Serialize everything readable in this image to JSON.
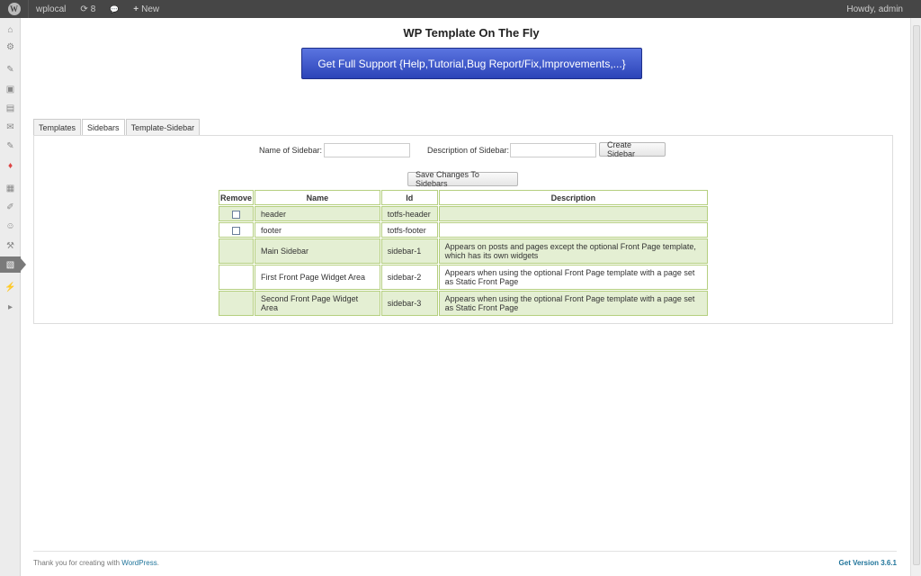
{
  "adminbar": {
    "site_name": "wplocal",
    "updates_count": "8",
    "new_label": "New",
    "howdy": "Howdy, admin"
  },
  "icons": {
    "wp": "W",
    "updates": "⟳",
    "comments": "💬",
    "new": "+"
  },
  "menu_icons": [
    "⌂",
    "⚙",
    "✎",
    "▣",
    "▤",
    "✉",
    "✎",
    "♦",
    "▦",
    "✐",
    "☺",
    "⚒",
    "▧",
    "⚡",
    "▸"
  ],
  "page": {
    "title": "WP Template On The Fly",
    "support_button": "Get Full Support {Help,Tutorial,Bug Report/Fix,Improvements,...}"
  },
  "tabs": [
    {
      "label": "Templates"
    },
    {
      "label": "Sidebars"
    },
    {
      "label": "Template-Sidebar"
    }
  ],
  "form": {
    "name_label": "Name of Sidebar:",
    "description_label": "Description of Sidebar:",
    "name_value": "",
    "description_value": "",
    "create_button": "Create Sidebar",
    "save_button": "Save Changes To Sidebars"
  },
  "table": {
    "headers": [
      "Remove",
      "Name",
      "Id",
      "Description"
    ],
    "rows": [
      {
        "name": "header",
        "id": "totfs-header",
        "description": ""
      },
      {
        "name": "footer",
        "id": "totfs-footer",
        "description": ""
      },
      {
        "name": "Main Sidebar",
        "id": "sidebar-1",
        "description": "Appears on posts and pages except the optional Front Page template, which has its own widgets"
      },
      {
        "name": "First Front Page Widget Area",
        "id": "sidebar-2",
        "description": "Appears when using the optional Front Page template with a page set as Static Front Page"
      },
      {
        "name": "Second Front Page Widget Area",
        "id": "sidebar-3",
        "description": "Appears when using the optional Front Page template with a page set as Static Front Page"
      }
    ]
  },
  "footer": {
    "thanks_prefix": "Thank you for creating with",
    "wordpress_link": "WordPress",
    "thanks_suffix": ".",
    "version": "Get Version 3.6.1"
  }
}
